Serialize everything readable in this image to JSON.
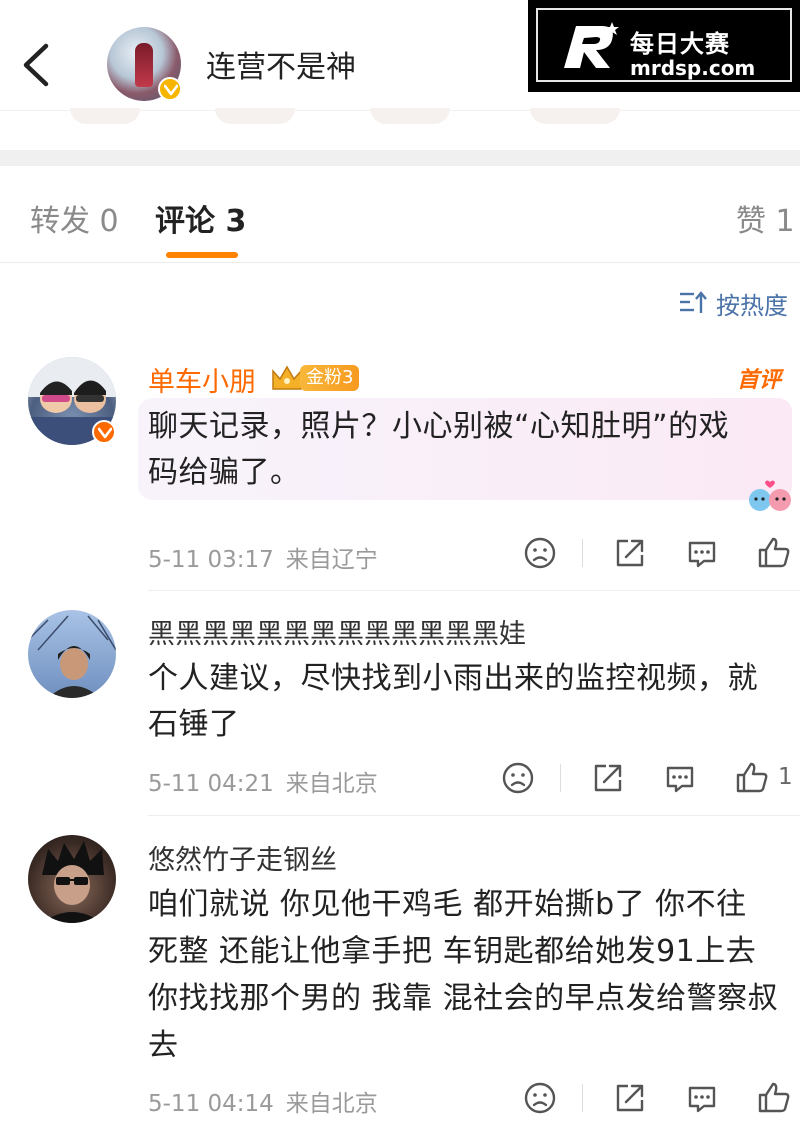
{
  "header": {
    "title": "连营不是神"
  },
  "watermark": {
    "title": "每日大赛",
    "url": "mrdsp.com"
  },
  "tabs": {
    "repost": "转发 0",
    "comments": "评论 3",
    "likes": "赞 1"
  },
  "sort": {
    "label": "按热度"
  },
  "colors": {
    "accent": "#ff8200",
    "name_highlight": "#ff6a00",
    "link_blue": "#4a73a8",
    "verified_gold": "#f7b500"
  },
  "comments": [
    {
      "name": "单车小朋",
      "fan_badge": "金粉3",
      "tag": "首评",
      "text_line1": "聊天记录，照片？小心别被“心知肚明”的戏",
      "text_line2": "码给骗了。",
      "time": "5-11 03:17",
      "location": "来自辽宁",
      "like_count": "",
      "icons": [
        "dislike-icon",
        "share-icon",
        "comment-icon",
        "like-icon"
      ]
    },
    {
      "name": "黑黑黑黑黑黑黑黑黑黑黑黑黑娃",
      "text_line1": "个人建议，尽快找到小雨出来的监控视频，就",
      "text_line2": "石锤了",
      "time": "5-11 04:21",
      "location": "来自北京",
      "like_count": "1",
      "icons": [
        "dislike-icon",
        "share-icon",
        "comment-icon",
        "like-icon"
      ]
    },
    {
      "name": "悠然竹子走钢丝",
      "text_line1": "咱们就说 你见他干鸡毛 都开始撕b了 你不往",
      "text_line2": "死整 还能让他拿手把 车钥匙都给她发91上去",
      "text_line3": "你找找那个男的 我靠 混社会的早点发给警察叔",
      "text_line4": "去",
      "time": "5-11 04:14",
      "location": "来自北京",
      "like_count": "",
      "icons": [
        "dislike-icon",
        "share-icon",
        "comment-icon",
        "like-icon"
      ]
    }
  ]
}
